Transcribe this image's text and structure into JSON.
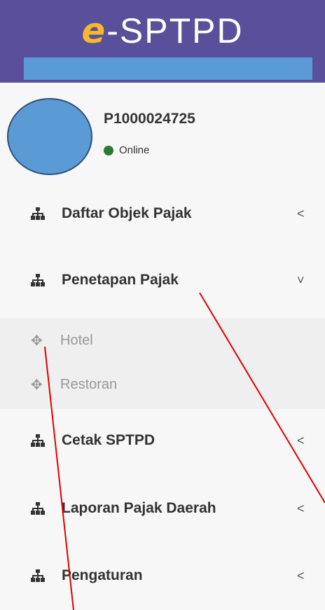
{
  "header": {
    "logo_e": "e",
    "logo_rest": "-SPTPD",
    "bar_color": "#5b9bd5",
    "background_color": "#5a4f9a"
  },
  "user": {
    "id": "P1000024725",
    "status": "Online",
    "status_color": "#2a7a32"
  },
  "menu": {
    "items": [
      {
        "label": "Daftar Objek Pajak",
        "icon": "sitemap-icon",
        "chevron": "<"
      },
      {
        "label": "Penetapan Pajak",
        "icon": "sitemap-icon",
        "chevron": "˅"
      },
      {
        "label": "Cetak SPTPD",
        "icon": "sitemap-icon",
        "chevron": "<"
      },
      {
        "label": "Laporan Pajak Daerah",
        "icon": "sitemap-icon",
        "chevron": "<"
      },
      {
        "label": "Pengaturan",
        "icon": "sitemap-icon",
        "chevron": "<"
      }
    ],
    "submenu": [
      {
        "label": "Hotel",
        "icon": "arrows-move-icon"
      },
      {
        "label": "Restoran",
        "icon": "arrows-move-icon"
      }
    ]
  },
  "annotation": {
    "line_color": "#e00000"
  }
}
